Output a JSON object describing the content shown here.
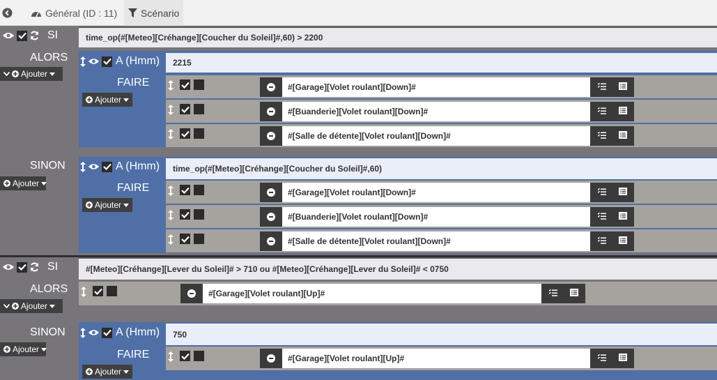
{
  "tabs": [
    {
      "label": "Général (ID : 11)"
    },
    {
      "label": "Scénario"
    }
  ],
  "labels": {
    "si": "SI",
    "alors": "ALORS",
    "sinon": "SINON",
    "faire": "FAIRE",
    "a_hmm": "A (Hmm)",
    "ajouter": "Ajouter"
  },
  "block1": {
    "condition": "time_op(#[Meteo][Créhange][Coucher du Soleil]#,60) > 2200",
    "alors": {
      "a_value": "2215",
      "commands": [
        "#[Garage][Volet roulant][Down]#",
        "#[Buanderie][Volet roulant][Down]#",
        "#[Salle de détente][Volet roulant][Down]#"
      ]
    },
    "sinon": {
      "a_value": "time_op(#[Meteo][Créhange][Coucher du Soleil]#,60)",
      "commands": [
        "#[Garage][Volet roulant][Down]#",
        "#[Buanderie][Volet roulant][Down]#",
        "#[Salle de détente][Volet roulant][Down]#"
      ]
    }
  },
  "block2": {
    "condition": "#[Meteo][Créhange][Lever du Soleil]# > 710 ou #[Meteo][Créhange][Lever du Soleil]#  < 0750",
    "alors": {
      "command": "#[Garage][Volet roulant][Up]#"
    },
    "sinon": {
      "a_value": "750",
      "commands": [
        "#[Garage][Volet roulant][Up]#"
      ]
    }
  }
}
